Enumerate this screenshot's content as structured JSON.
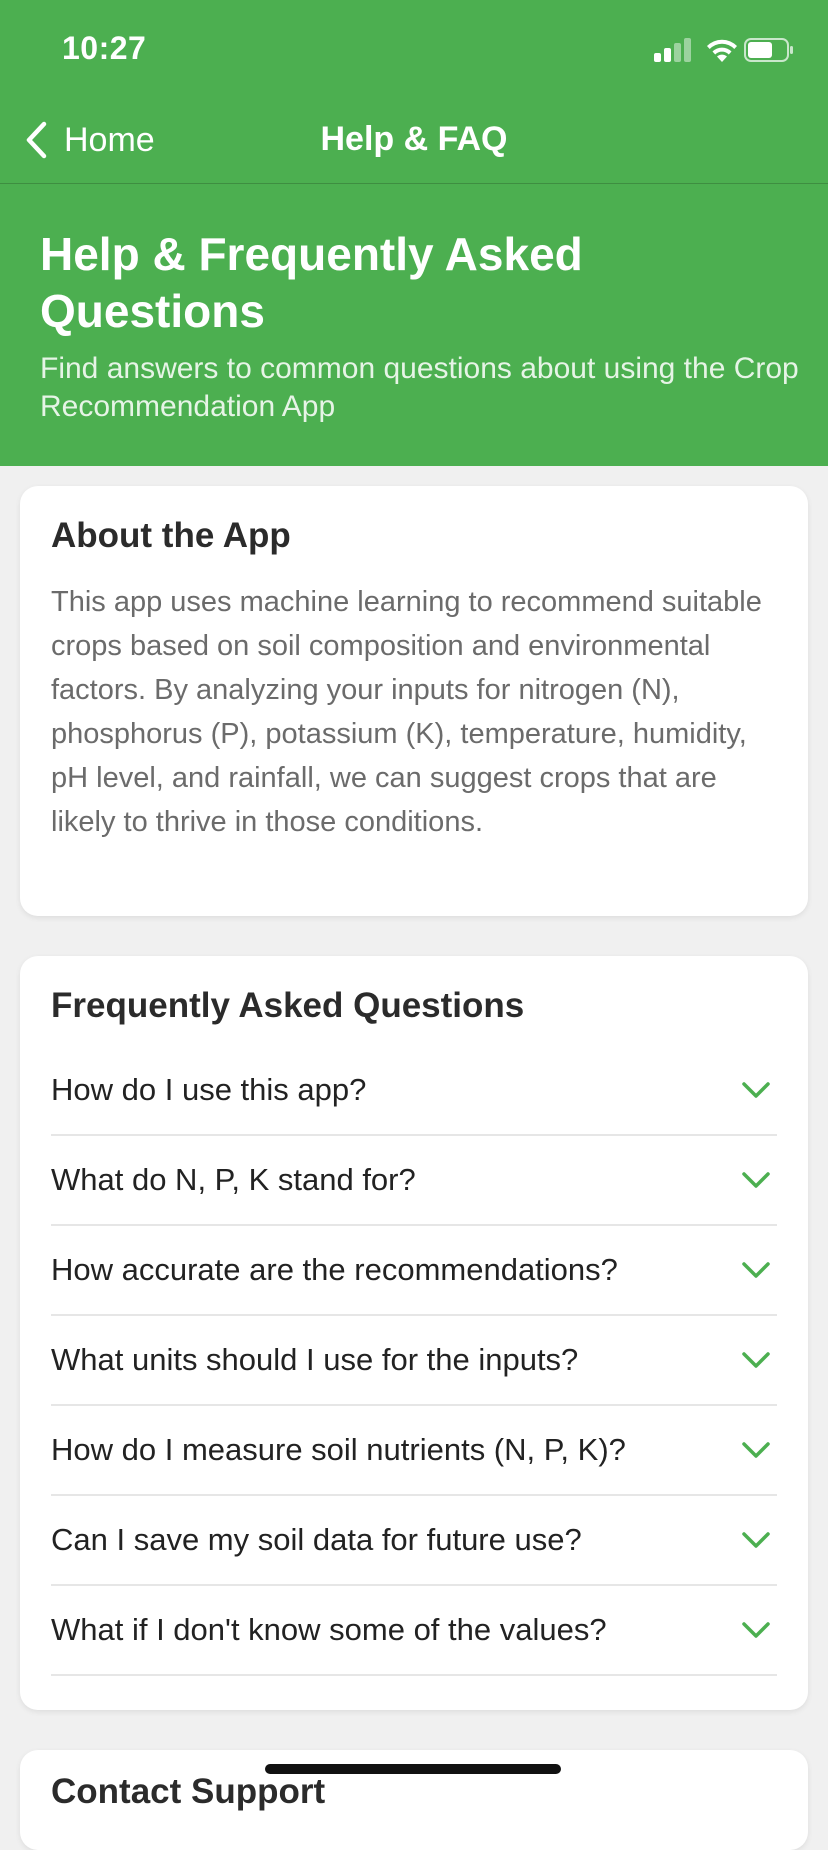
{
  "status_bar": {
    "time": "10:27"
  },
  "nav": {
    "back_label": "Home",
    "title": "Help & FAQ"
  },
  "hero": {
    "title": "Help & Frequently Asked Questions",
    "subtitle": "Find answers to common questions about using the Crop Recommendation App"
  },
  "about": {
    "title": "About the App",
    "text": "This app uses machine learning to recommend suitable crops based on soil composition and environmental factors. By analyzing your inputs for nitrogen (N), phosphorus (P), potassium (K), temperature, humidity, pH level, and rainfall, we can suggest crops that are likely to thrive in those conditions."
  },
  "faq": {
    "title": "Frequently Asked Questions",
    "items": [
      {
        "question": "How do I use this app?"
      },
      {
        "question": "What do N, P, K stand for?"
      },
      {
        "question": "How accurate are the recommendations?"
      },
      {
        "question": "What units should I use for the inputs?"
      },
      {
        "question": "How do I measure soil nutrients (N, P, K)?"
      },
      {
        "question": "Can I save my soil data for future use?"
      },
      {
        "question": "What if I don't know some of the values?"
      }
    ]
  },
  "contact": {
    "title": "Contact Support"
  },
  "colors": {
    "brand_green": "#4caf50",
    "chevron_green": "#4caf50",
    "background": "#f0f0f0"
  },
  "icons": {
    "back": "chevron-left-icon",
    "expand": "chevron-down-icon",
    "signal": "cellular-signal-icon",
    "wifi": "wifi-icon",
    "battery": "battery-icon"
  }
}
